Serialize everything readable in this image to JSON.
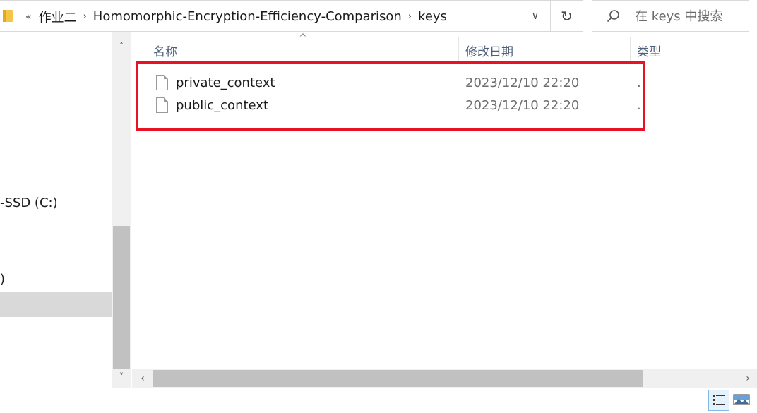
{
  "address_bar": {
    "overflow": "«",
    "crumbs": [
      {
        "label": "作业二"
      },
      {
        "label": "Homomorphic-Encryption-Efficiency-Comparison"
      },
      {
        "label": "keys"
      }
    ],
    "separator": "›",
    "dropdown": "∨",
    "refresh": "↻"
  },
  "search": {
    "placeholder": "在 keys 中搜索"
  },
  "nav": {
    "items": [
      {
        "label": "-SSD (C:)"
      },
      {
        "label": ")"
      },
      {
        "label": ""
      }
    ],
    "scroll_up": "˄",
    "scroll_down": "˅"
  },
  "list": {
    "sort_indicator": "^",
    "columns": [
      "名称",
      "修改日期",
      "类型"
    ],
    "rows": [
      {
        "name": "private_context",
        "modified": "2023/12/10 22:20",
        "type": "."
      },
      {
        "name": "public_context",
        "modified": "2023/12/10 22:20",
        "type": "."
      }
    ]
  },
  "hscroll": {
    "left": "‹",
    "right": "›"
  },
  "colors": {
    "highlight": "#e81224",
    "header_text": "#4c607a",
    "selection": "#d9d9d9"
  },
  "icons": [
    "folder-icon",
    "search-icon",
    "refresh-icon",
    "file-icon",
    "details-view-icon",
    "large-icons-view-icon"
  ]
}
